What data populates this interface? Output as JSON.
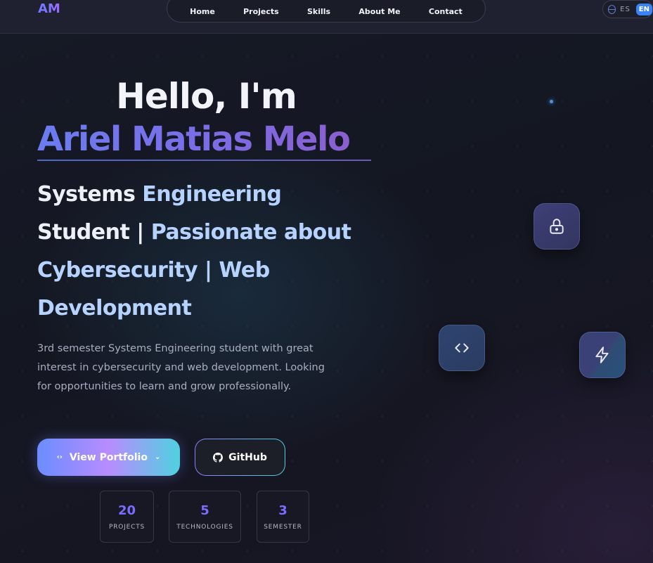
{
  "header": {
    "logo": "AM",
    "nav": [
      "Home",
      "Projects",
      "Skills",
      "About Me",
      "Contact"
    ],
    "lang": {
      "es": "ES",
      "en": "EN"
    }
  },
  "hero": {
    "greeting": "Hello, I'm",
    "name": "Ariel Matias Melo",
    "subtitle": {
      "line1_a": "Systems",
      "line1_b": "Engineering",
      "line2_a": "Student |",
      "line2_b": "Passionate about",
      "line3_a": "Cybersecurity |",
      "line3_b": "Web",
      "line4": "Development"
    },
    "description": "3rd semester Systems Engineering student with great interest in cybersecurity and web development. Looking for opportunities to learn and grow professionally.",
    "primary_button": "View Portfolio",
    "secondary_button": "GitHub"
  },
  "stats": [
    {
      "value": "20",
      "label": "PROJECTS"
    },
    {
      "value": "5",
      "label": "TECHNOLOGIES"
    },
    {
      "value": "3",
      "label": "SEMESTER"
    }
  ],
  "icons": {
    "float1": "lock-icon",
    "float2": "code-icon",
    "float3": "lightning-icon"
  },
  "colors": {
    "background": "#14161f",
    "accent_purple": "#7a6cff",
    "accent_blue": "#3b82f6",
    "accent_cyan": "#4fd1e0"
  }
}
